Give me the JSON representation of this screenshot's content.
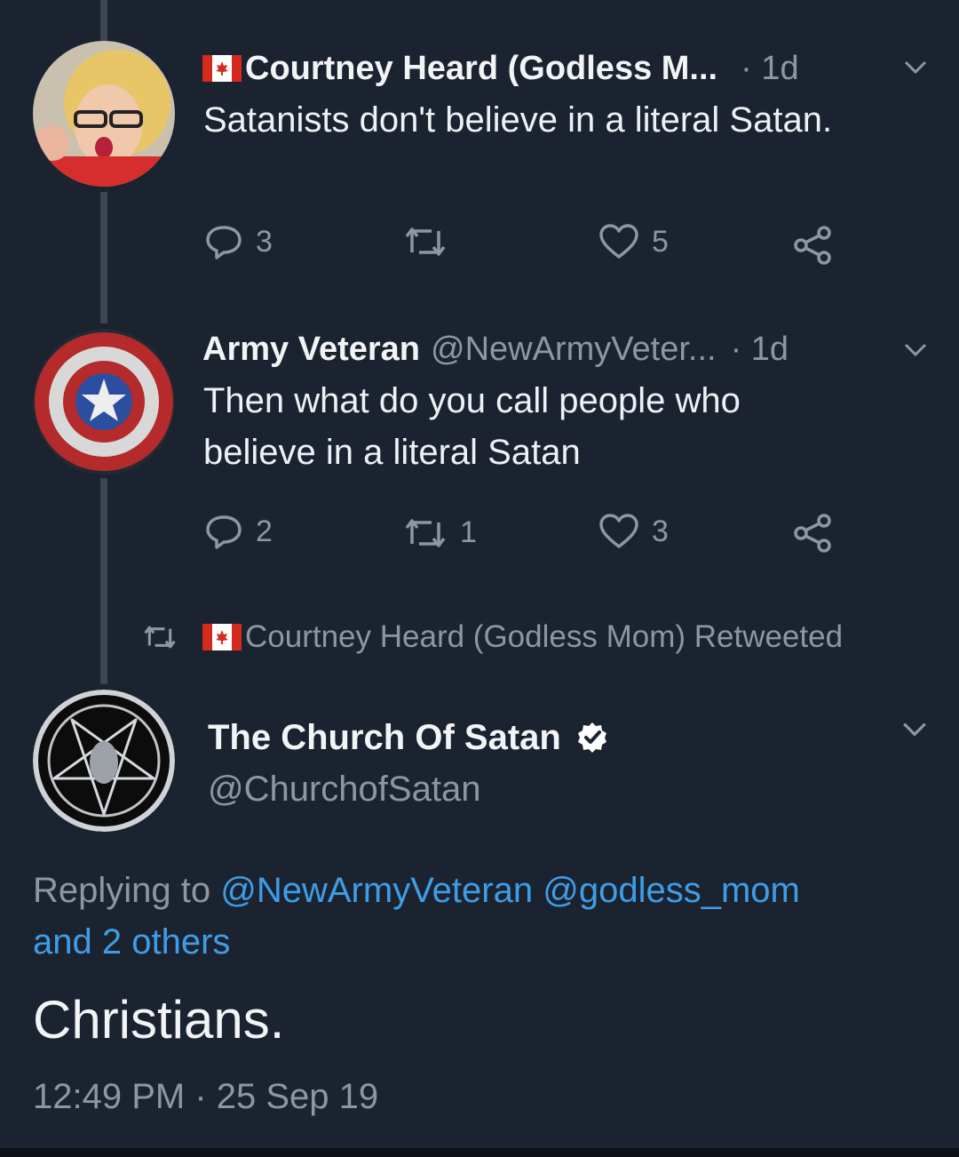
{
  "tweet1": {
    "name": "Courtney Heard (Godless M...",
    "time": "· 1d",
    "text": "Satanists don't believe in a literal Satan.",
    "replies": "3",
    "retweets": "",
    "likes": "5"
  },
  "tweet2": {
    "name": "Army Veteran",
    "handle": "@NewArmyVeter...",
    "time": "· 1d",
    "text_line1": "Then what do you call people who",
    "text_line2": "believe in a literal Satan",
    "replies": "2",
    "retweets": "1",
    "likes": "3"
  },
  "retweet_banner": "Courtney Heard (Godless Mom) Retweeted",
  "main_tweet": {
    "name": "The Church Of Satan",
    "handle": "@ChurchofSatan",
    "replying_prefix": "Replying to",
    "mention1": "@NewArmyVeteran",
    "mention2": "@godless_mom",
    "others": "and 2 others",
    "text": "Christians.",
    "timestamp": "12:49 PM · 25 Sep 19"
  },
  "colors": {
    "background": "#1b2330",
    "link": "#3f9de6",
    "secondary_text": "#8c97a3",
    "thread_line": "#3c4550"
  }
}
